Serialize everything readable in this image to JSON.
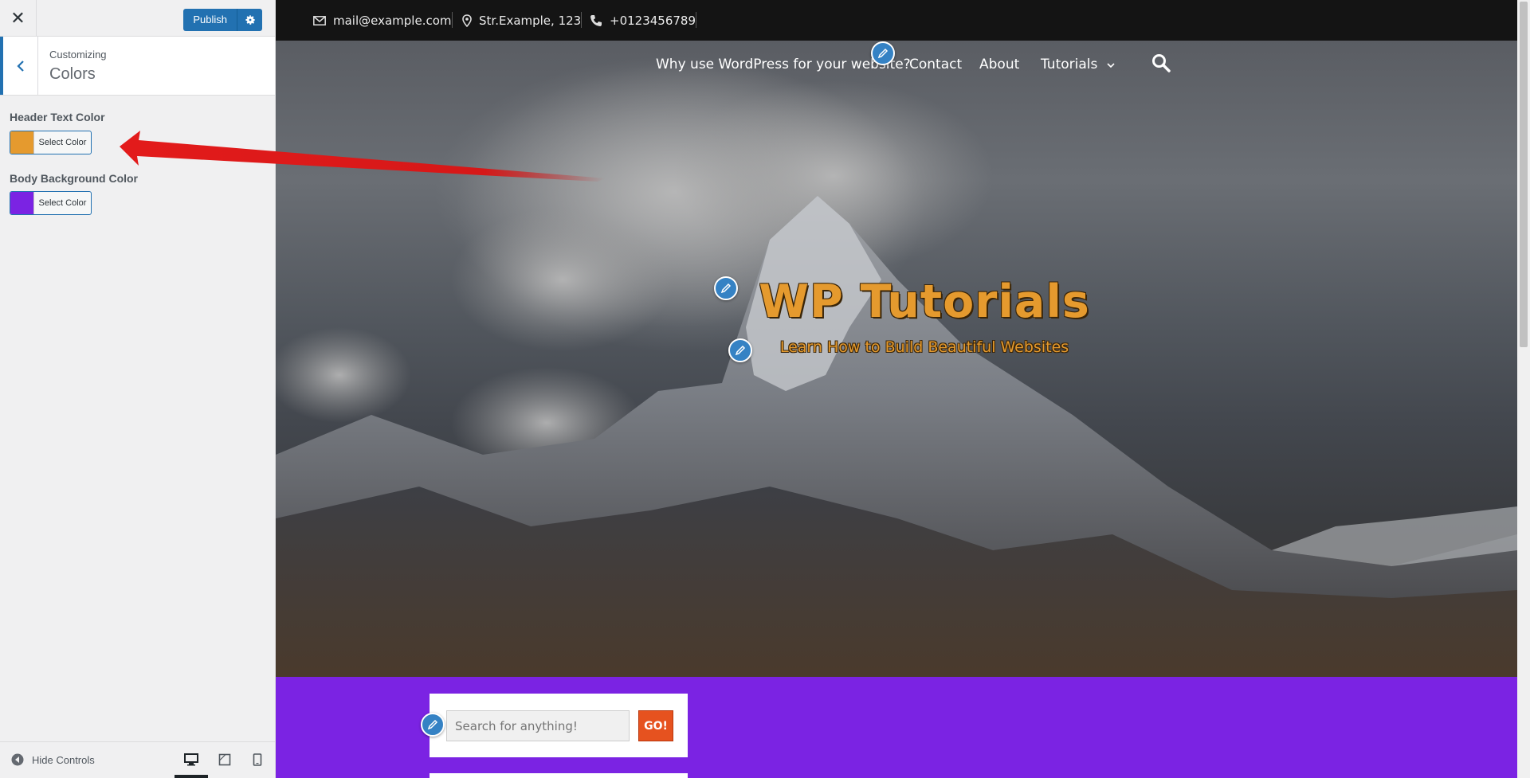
{
  "sidebar": {
    "close_icon": "close-icon",
    "publish_label": "Publish",
    "publish_settings_icon": "gear-icon",
    "back_icon": "chevron-left-icon",
    "customizing_label": "Customizing",
    "section_name": "Colors",
    "controls": [
      {
        "label": "Header Text Color",
        "button_label": "Select Color",
        "color": "#e59a2e"
      },
      {
        "label": "Body Background Color",
        "button_label": "Select Color",
        "color": "#7b23e3"
      }
    ],
    "footer": {
      "hide_controls_label": "Hide Controls",
      "devices": [
        "desktop-icon",
        "tablet-icon",
        "mobile-icon"
      ],
      "active_device": "desktop"
    }
  },
  "preview": {
    "topbar": {
      "email": "mail@example.com",
      "address": "Str.Example, 123",
      "phone": "+0123456789"
    },
    "nav": {
      "items": [
        "Why use WordPress for your website?",
        "Contact",
        "About",
        "Tutorials"
      ],
      "search_icon": "search-icon"
    },
    "site_title": "WP Tutorials",
    "site_tagline": "Learn How to Build Beautiful Websites",
    "search_widget": {
      "placeholder": "Search for anything!",
      "button_label": "GO!"
    }
  },
  "colors": {
    "accent": "#2271b1",
    "header_text": "#e59a2e",
    "body_background": "#7b23e3",
    "go_button": "#e6521f",
    "annotation_arrow": "#e31b1b"
  }
}
